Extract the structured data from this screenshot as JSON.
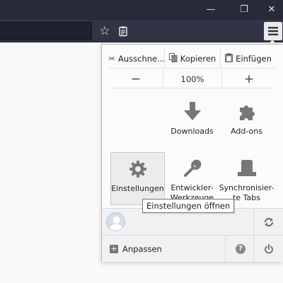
{
  "window_controls": {
    "minimize": "—",
    "maximize": "❐",
    "close": "✕"
  },
  "toolbar": {
    "bookmark_icon": "star-icon",
    "reader_icon": "reader-view-icon",
    "menu_icon": "hamburger-menu-icon"
  },
  "menu": {
    "edit": {
      "cut": "Ausschne...",
      "copy": "Kopieren",
      "paste": "Einfügen"
    },
    "zoom": {
      "zoom_out": "−",
      "level": "100%",
      "zoom_in": "+"
    },
    "items": [
      {
        "id": "downloads",
        "label": "Downloads",
        "icon": "download-arrow-icon"
      },
      {
        "id": "addons",
        "label": "Add-ons",
        "icon": "puzzle-icon"
      },
      {
        "id": "settings",
        "label": "Einstellungen",
        "icon": "gear-icon"
      },
      {
        "id": "devtools",
        "label": "Entwickler-\nWerkzeuge",
        "icon": "wrench-icon"
      },
      {
        "id": "synced_tabs",
        "label": "Synchronisier-\nte Tabs",
        "icon": "synced-tabs-icon"
      }
    ],
    "footer": {
      "customize": "Anpassen",
      "sync_icon": "sync-icon",
      "help_icon": "help-icon",
      "quit_icon": "power-icon"
    }
  },
  "tooltip": "Einstellungen öffnen",
  "colors": {
    "titlebar": "#282a3a",
    "navbar": "#323446",
    "panel": "#fbfbfb",
    "icon_gray": "#777777"
  }
}
